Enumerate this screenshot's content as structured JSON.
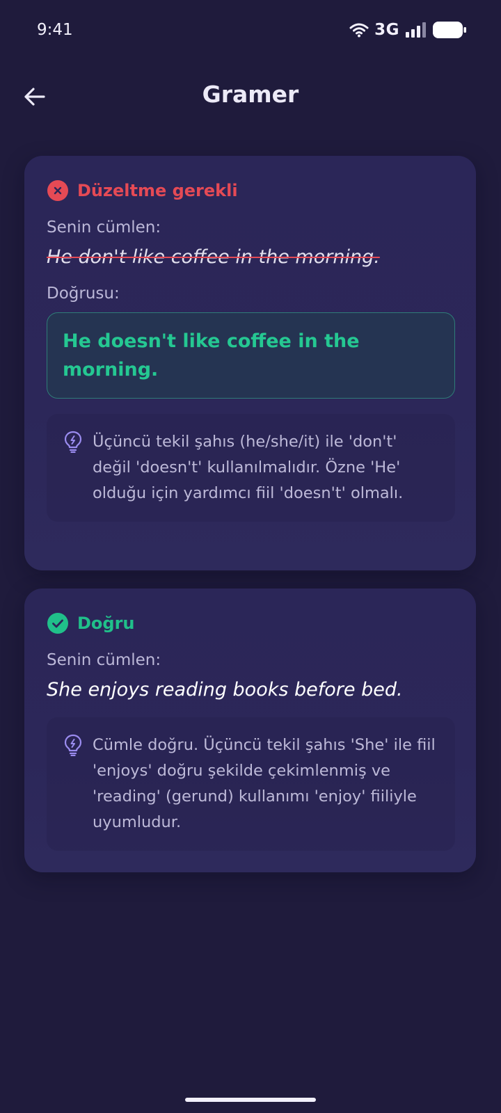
{
  "status_bar": {
    "time": "9:41",
    "network": "3G"
  },
  "header": {
    "title": "Gramer"
  },
  "cards": [
    {
      "status": "Düzeltme gerekli",
      "your_sentence_label": "Senin cümlen:",
      "your_sentence": "He don't like coffee in the morning.",
      "correct_label": "Doğrusu:",
      "correct_sentence": "He doesn't like coffee in the morning.",
      "tip": "Üçüncü tekil şahıs (he/she/it) ile 'don't' değil 'doesn't' kullanılmalıdır. Özne 'He' olduğu için yardımcı fiil 'doesn't' olmalı."
    },
    {
      "status": "Doğru",
      "your_sentence_label": "Senin cümlen:",
      "your_sentence": "She enjoys reading books before bed.",
      "tip": "Cümle doğru. Üçüncü tekil şahıs 'She' ile fiil 'enjoys' doğru şekilde çekimlenmiş ve 'reading' (gerund) kullanımı 'enjoy' fiiliyle uyumludur."
    }
  ],
  "colors": {
    "background": "#1f1b3c",
    "card": "#2b2658",
    "error": "#e54a55",
    "success": "#20c08a",
    "correct_text": "#25c892",
    "tip_icon": "#9b8cf0"
  },
  "icons": {
    "back": "arrow-left-icon",
    "error": "x-circle-icon",
    "success": "check-circle-icon",
    "tip": "lightbulb-icon",
    "wifi": "wifi-icon",
    "signal": "signal-icon",
    "battery": "battery-icon"
  }
}
